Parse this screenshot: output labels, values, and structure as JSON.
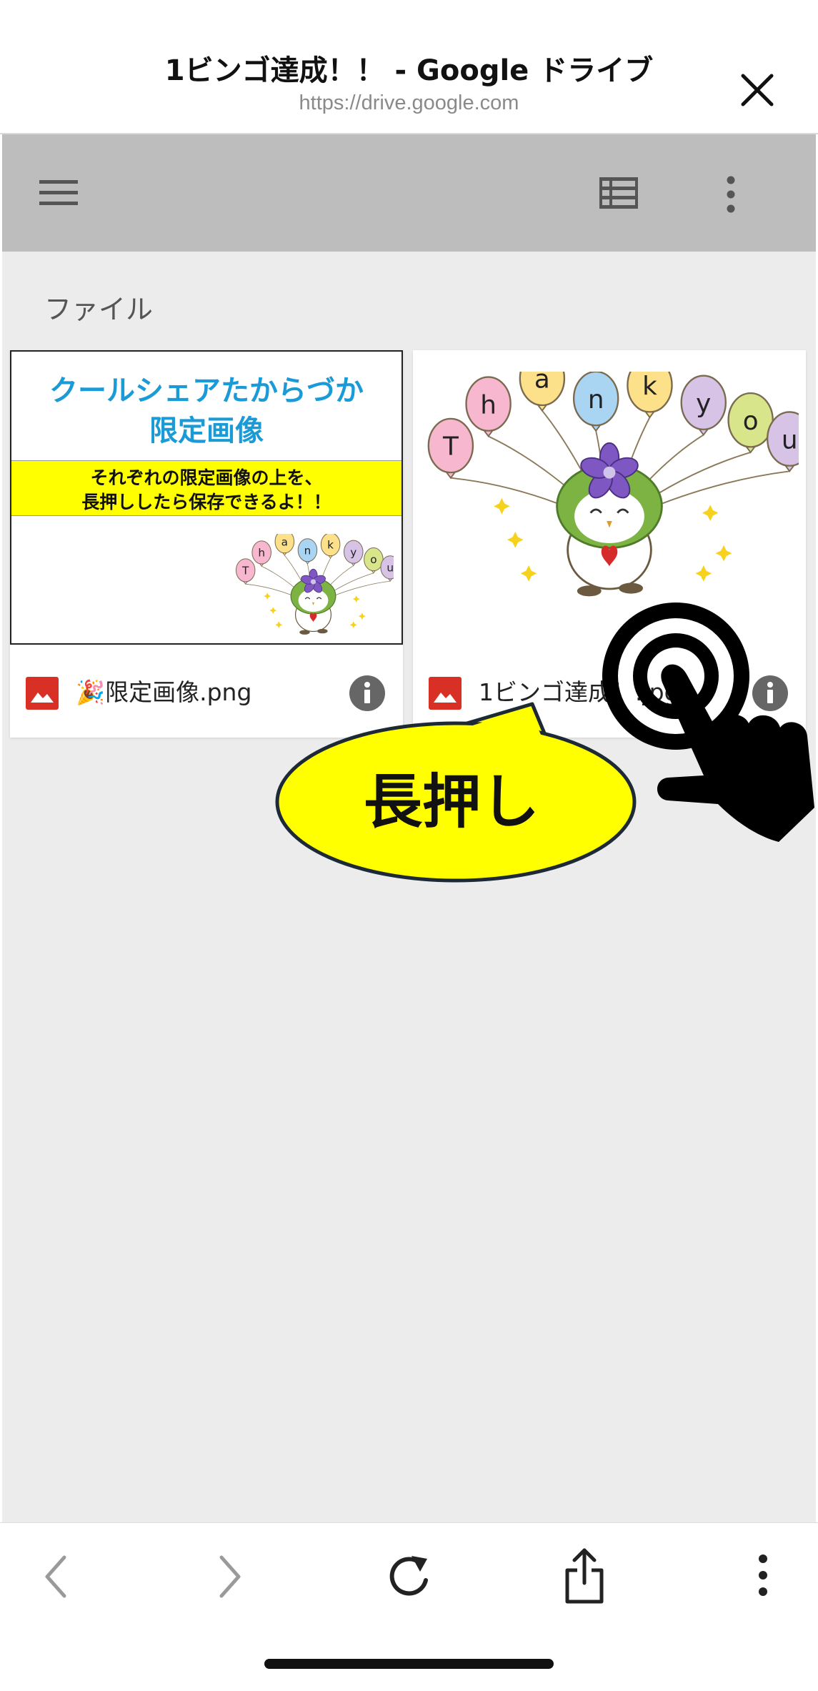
{
  "header": {
    "title": "1ビンゴ達成！！ - Google ドライブ",
    "url": "https://drive.google.com"
  },
  "toolbar": {
    "menu_icon": "hamburger-menu-icon",
    "list_view_icon": "list-view-icon",
    "more_icon": "more-vertical-icon"
  },
  "section": {
    "label": "ファイル"
  },
  "files": [
    {
      "name": "🎉限定画像.png",
      "thumb": {
        "heading_line1": "クールシェアたからづか",
        "heading_line2": "限定画像",
        "note_line1": "それぞれの限定画像の上を、",
        "note_line2": "長押ししたら保存できるよ！！"
      }
    },
    {
      "name": "1ビンゴ達成！.jpg"
    }
  ],
  "balloon_letters": [
    "T",
    "h",
    "a",
    "n",
    "k",
    "y",
    "o",
    "u"
  ],
  "overlay": {
    "callout": "長押し"
  },
  "bottom_bar": {
    "back_icon": "chevron-left-icon",
    "forward_icon": "chevron-right-icon",
    "reload_icon": "reload-icon",
    "share_icon": "share-icon",
    "more_icon": "more-vertical-icon"
  },
  "colors": {
    "accent_blue": "#1a9ad6",
    "banner_yellow": "#ffff00",
    "image_red": "#d93025",
    "toolbar_gray": "#bdbdbd",
    "content_gray": "#ececec"
  }
}
